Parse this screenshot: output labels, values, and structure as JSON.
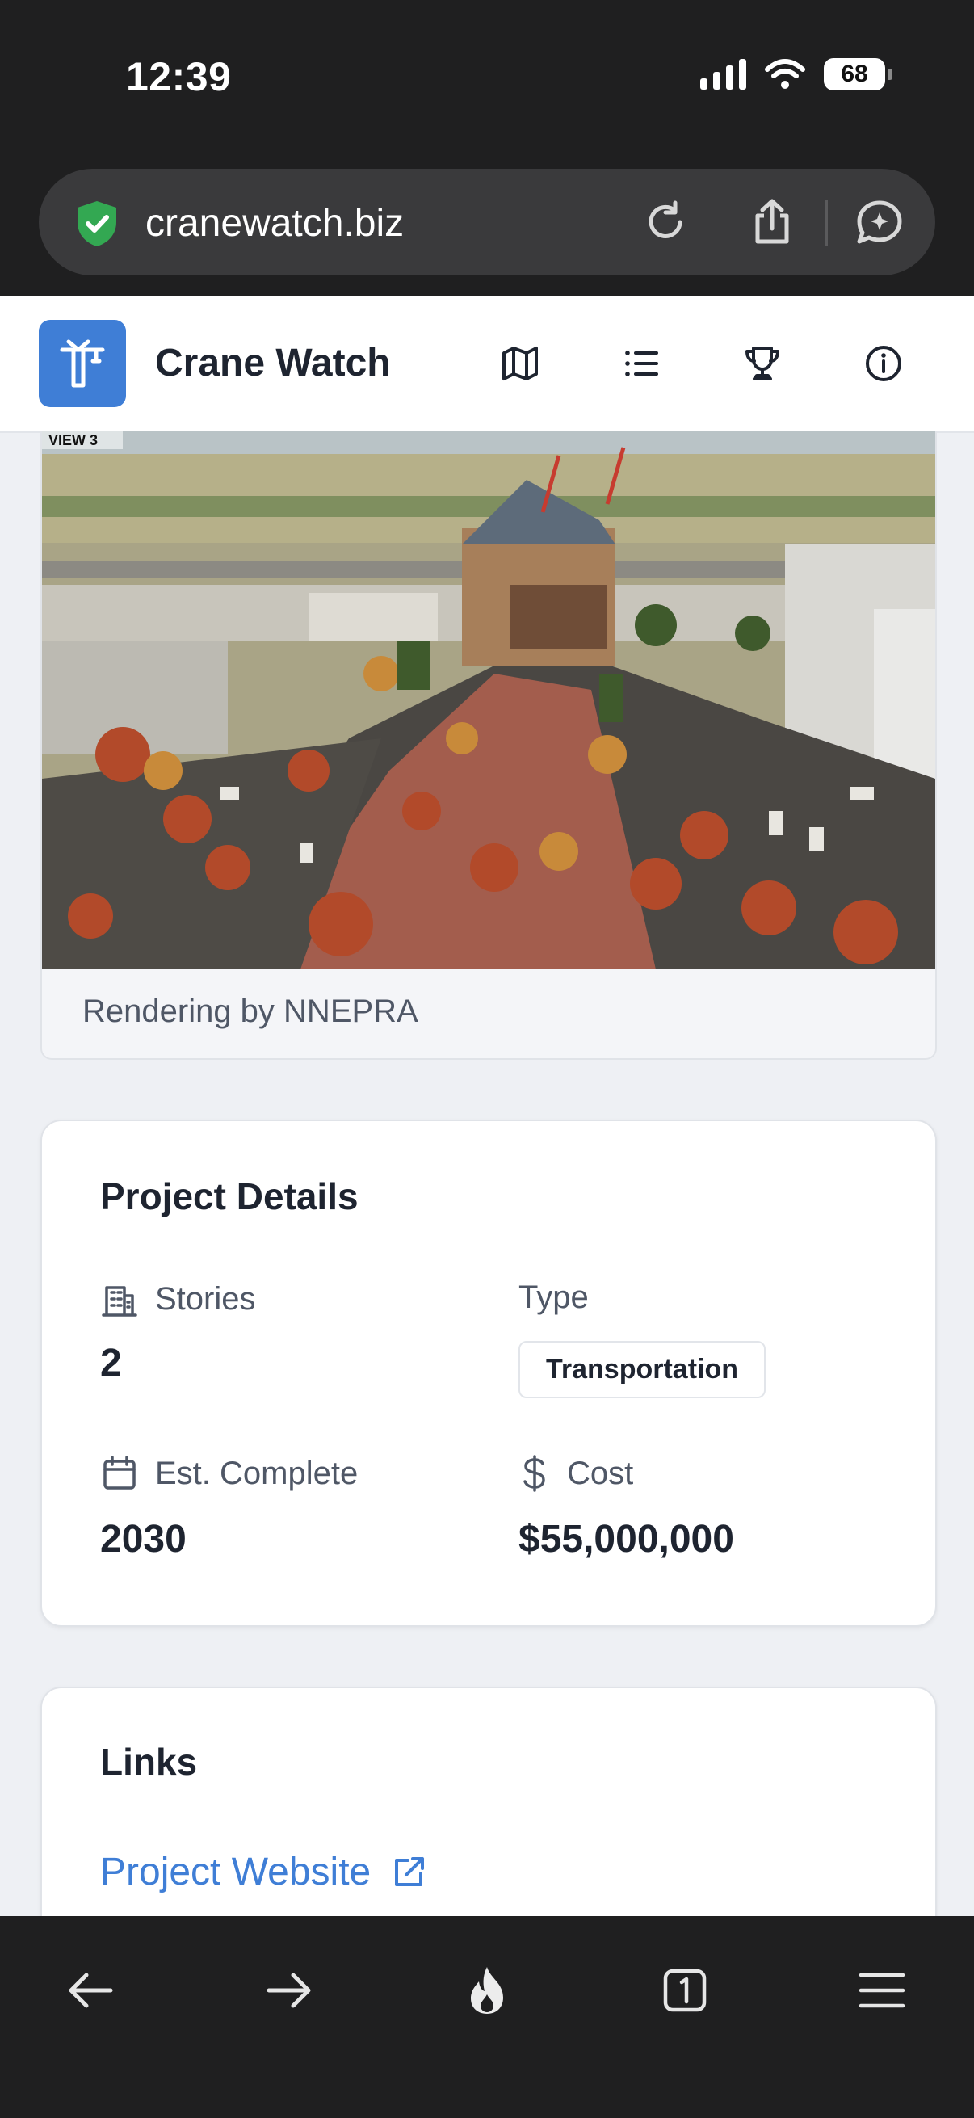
{
  "status": {
    "time": "12:39",
    "battery": "68"
  },
  "browser": {
    "url": "cranewatch.biz"
  },
  "app": {
    "title": "Crane Watch"
  },
  "hero": {
    "view_label": "VIEW 3",
    "caption": "Rendering by NNEPRA"
  },
  "details": {
    "title": "Project Details",
    "stories_label": "Stories",
    "stories_value": "2",
    "type_label": "Type",
    "type_value": "Transportation",
    "complete_label": "Est. Complete",
    "complete_value": "2030",
    "cost_label": "Cost",
    "cost_value": "$55,000,000"
  },
  "links": {
    "title": "Links",
    "website_label": "Project Website"
  },
  "colors": {
    "accent": "#3f7ed6",
    "chrome": "#1f1f20",
    "page_bg": "#eef0f4"
  }
}
